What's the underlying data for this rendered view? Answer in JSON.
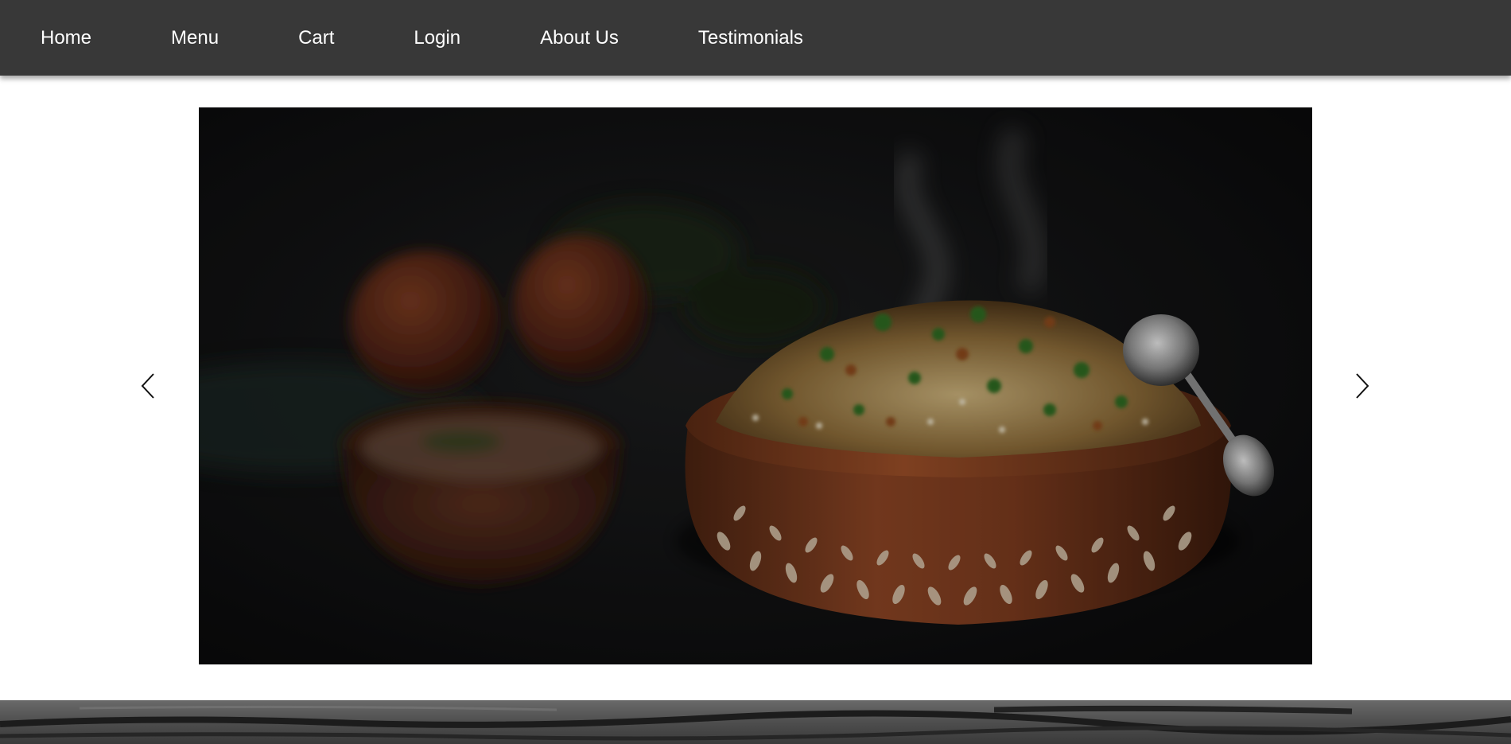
{
  "nav": {
    "items": [
      {
        "label": "Home"
      },
      {
        "label": "Menu"
      },
      {
        "label": "Cart"
      },
      {
        "label": "Login"
      },
      {
        "label": "About Us"
      },
      {
        "label": "Testimonials"
      }
    ],
    "background": "#383838",
    "text_color": "#ffffff"
  },
  "carousel": {
    "prev_icon": "chevron-left-icon",
    "next_icon": "chevron-right-icon",
    "slide_image": "biryani-clay-pot-photo"
  },
  "footer": {
    "image": "dark-wood-texture"
  }
}
